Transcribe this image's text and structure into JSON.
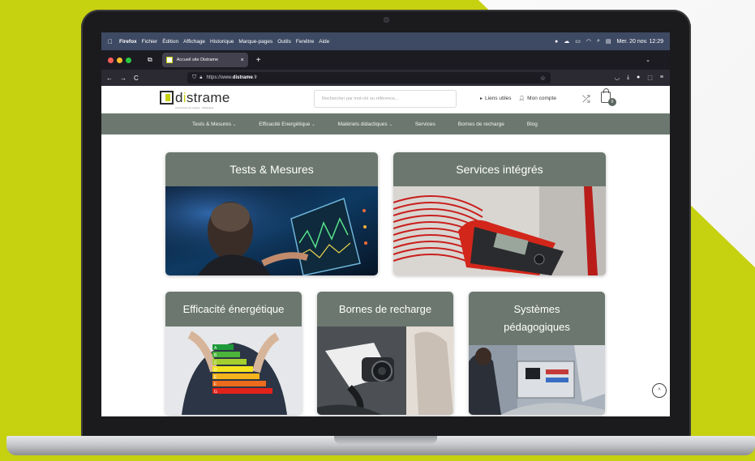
{
  "menubar": {
    "apple_icon": "apple-icon",
    "items": [
      "Firefox",
      "Fichier",
      "Édition",
      "Affichage",
      "Historique",
      "Marque-pages",
      "Outils",
      "Fenêtre",
      "Aide"
    ],
    "datetime": "Mer. 20 nov.  12:29"
  },
  "browser": {
    "tab_title": "Accueil site Distrame",
    "tab_close": "×",
    "new_tab": "+",
    "back": "←",
    "forward": "→",
    "reload": "C",
    "url_prefix": "https://www.",
    "url_domain": "distrame",
    "url_suffix": ".fr",
    "star": "☆"
  },
  "site": {
    "logo_d": "D",
    "logo_text_a": "d",
    "logo_text_i": "i",
    "logo_text_b": "strame",
    "logo_tagline": "Instruments de mesure · Didactique",
    "search_placeholder": "Rechercher par mot-clé ou référence...",
    "useful_links": "Liens utiles",
    "account": "Mon compte",
    "cart_count": "0",
    "nav": [
      {
        "label": "Tests & Mesures",
        "caret": "⌄"
      },
      {
        "label": "Efficacité Energétique",
        "caret": "⌄"
      },
      {
        "label": "Matériels didactiques",
        "caret": "⌄"
      },
      {
        "label": "Services",
        "caret": ""
      },
      {
        "label": "Bornes de recharge",
        "caret": ""
      },
      {
        "label": "Blog",
        "caret": ""
      }
    ],
    "cards": [
      {
        "title": "Tests & Mesures"
      },
      {
        "title": "Services intégrés"
      },
      {
        "title": "Efficacité énergétique"
      },
      {
        "title": "Bornes de recharge"
      },
      {
        "title_line1": "Systèmes",
        "title_line2": "pédagogiques"
      }
    ],
    "energy_labels": [
      "A",
      "B",
      "C",
      "D",
      "E",
      "F",
      "G"
    ],
    "scroll_top": "^"
  },
  "colors": {
    "brand_lime": "#c6d110",
    "nav_gray_green": "#6c786f",
    "menubar_blue": "#3e4a63"
  }
}
